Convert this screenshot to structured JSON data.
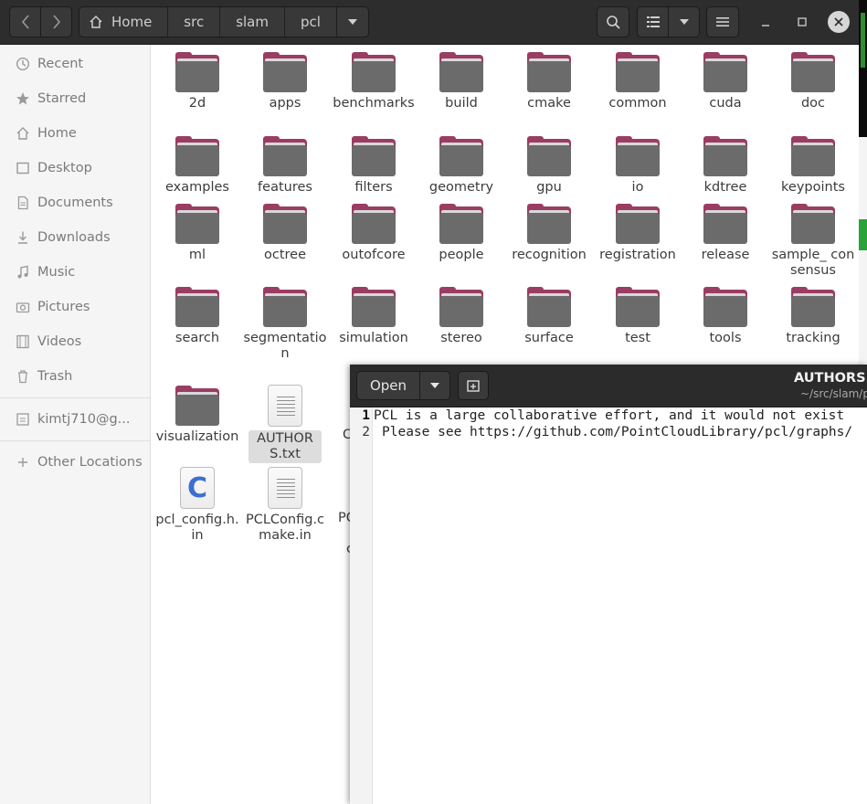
{
  "file_manager": {
    "breadcrumbs": [
      "Home",
      "src",
      "slam",
      "pcl"
    ],
    "sidebar": [
      {
        "label": "Recent",
        "icon": "clock-icon"
      },
      {
        "label": "Starred",
        "icon": "star-icon"
      },
      {
        "label": "Home",
        "icon": "home-icon"
      },
      {
        "label": "Desktop",
        "icon": "desktop-icon"
      },
      {
        "label": "Documents",
        "icon": "document-icon"
      },
      {
        "label": "Downloads",
        "icon": "download-icon"
      },
      {
        "label": "Music",
        "icon": "music-icon"
      },
      {
        "label": "Pictures",
        "icon": "camera-icon"
      },
      {
        "label": "Videos",
        "icon": "film-icon"
      },
      {
        "label": "Trash",
        "icon": "trash-icon"
      },
      {
        "label": "kimtj710@g...",
        "icon": "account-icon"
      },
      {
        "label": "Other Locations",
        "icon": "plus-icon"
      }
    ],
    "folders": [
      {
        "label": "2d"
      },
      {
        "label": "apps"
      },
      {
        "label": "benchmarks"
      },
      {
        "label": "build"
      },
      {
        "label": "cmake"
      },
      {
        "label": "common"
      },
      {
        "label": "cuda"
      },
      {
        "label": "doc"
      },
      {
        "label": "examples"
      },
      {
        "label": "features"
      },
      {
        "label": "filters"
      },
      {
        "label": "geometry"
      },
      {
        "label": "gpu"
      },
      {
        "label": "io"
      },
      {
        "label": "kdtree"
      },
      {
        "label": "keypoints"
      },
      {
        "label": "ml"
      },
      {
        "label": "octree"
      },
      {
        "label": "outofcore"
      },
      {
        "label": "people"
      },
      {
        "label": "recognition"
      },
      {
        "label": "registration"
      },
      {
        "label": "release"
      },
      {
        "label": "sample_ consensus"
      },
      {
        "label": "search"
      },
      {
        "label": "segmentation"
      },
      {
        "label": "simulation"
      },
      {
        "label": "stereo"
      },
      {
        "label": "surface"
      },
      {
        "label": "test"
      },
      {
        "label": "tools"
      },
      {
        "label": "tracking"
      },
      {
        "label": "visualization"
      }
    ],
    "files": [
      {
        "label": "AUTHORS.txt",
        "kind": "text",
        "selected": true
      },
      {
        "label": "pcl_config.h.in",
        "kind": "c-source"
      },
      {
        "label": "PCLConfig.cmake.in",
        "kind": "text"
      }
    ],
    "partial_labels": [
      "C",
      "PC",
      "c"
    ]
  },
  "editor": {
    "open_label": "Open",
    "title": "AUTHORS.t",
    "path": "~/src/slam/p",
    "lines": [
      {
        "number": "1",
        "text": "PCL is a large collaborative effort, and it would not exist"
      },
      {
        "number": "2",
        "text": "Please see https://github.com/PointCloudLibrary/pcl/graphs/"
      }
    ]
  }
}
